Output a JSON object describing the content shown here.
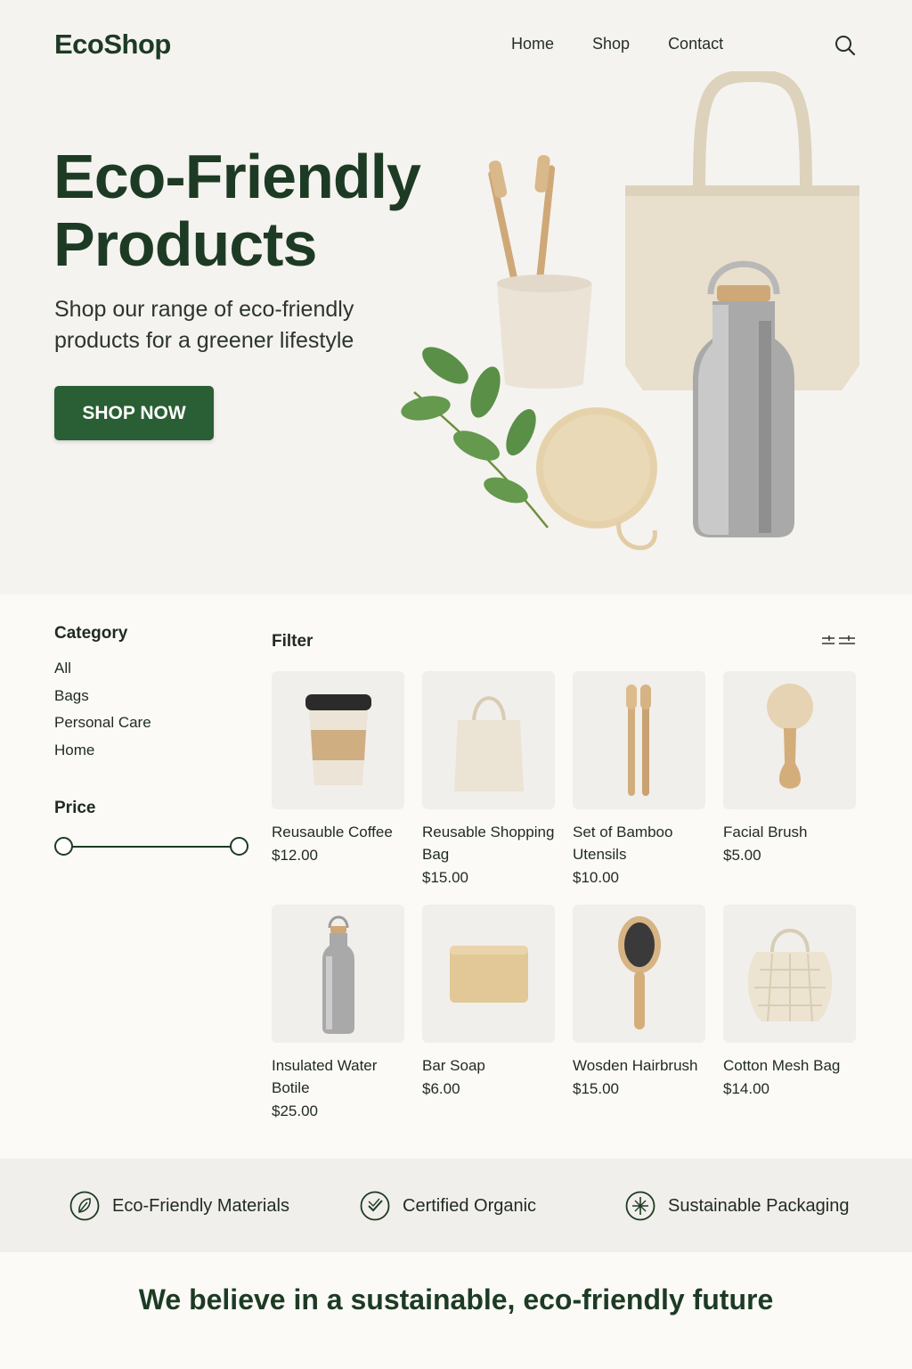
{
  "header": {
    "logo": "EcoShop",
    "nav": [
      "Home",
      "Shop",
      "Contact"
    ]
  },
  "hero": {
    "title": "Eco-Friendly Products",
    "subtitle": "Shop our range of eco-friendly products for a greener lifestyle",
    "cta": "SHOP NOW"
  },
  "sidebar": {
    "category_heading": "Category",
    "categories": [
      "All",
      "Bags",
      "Personal Care",
      "Home"
    ],
    "price_heading": "Price"
  },
  "products_header": {
    "filter_label": "Filter"
  },
  "products": [
    {
      "name": "Reusauble Coffee",
      "price": "$12.00",
      "icon": "coffee-cup"
    },
    {
      "name": "Reusable Shopping Bag",
      "price": "$15.00",
      "icon": "tote-bag"
    },
    {
      "name": "Set of Bamboo Utensils",
      "price": "$10.00",
      "icon": "bamboo-utensils"
    },
    {
      "name": "Facial Brush",
      "price": "$5.00",
      "icon": "facial-brush"
    },
    {
      "name": "Insulated Water Botile",
      "price": "$25.00",
      "icon": "water-bottle"
    },
    {
      "name": "Bar Soap",
      "price": "$6.00",
      "icon": "soap-bar"
    },
    {
      "name": "Wosden Hairbrush",
      "price": "$15.00",
      "icon": "hairbrush"
    },
    {
      "name": "Cotton Mesh Bag",
      "price": "$14.00",
      "icon": "mesh-bag"
    }
  ],
  "features": [
    {
      "label": "Eco-Friendly Materials",
      "icon": "leaf-icon"
    },
    {
      "label": "Certified Organic",
      "icon": "check-icon"
    },
    {
      "label": "Sustainable Packaging",
      "icon": "recycle-icon"
    }
  ],
  "tagline": "We believe in a sustainable, eco-friendly future",
  "colors": {
    "brand_green": "#1d3b24",
    "button_green": "#2a5e34",
    "hero_bg": "#f5f3ef"
  }
}
